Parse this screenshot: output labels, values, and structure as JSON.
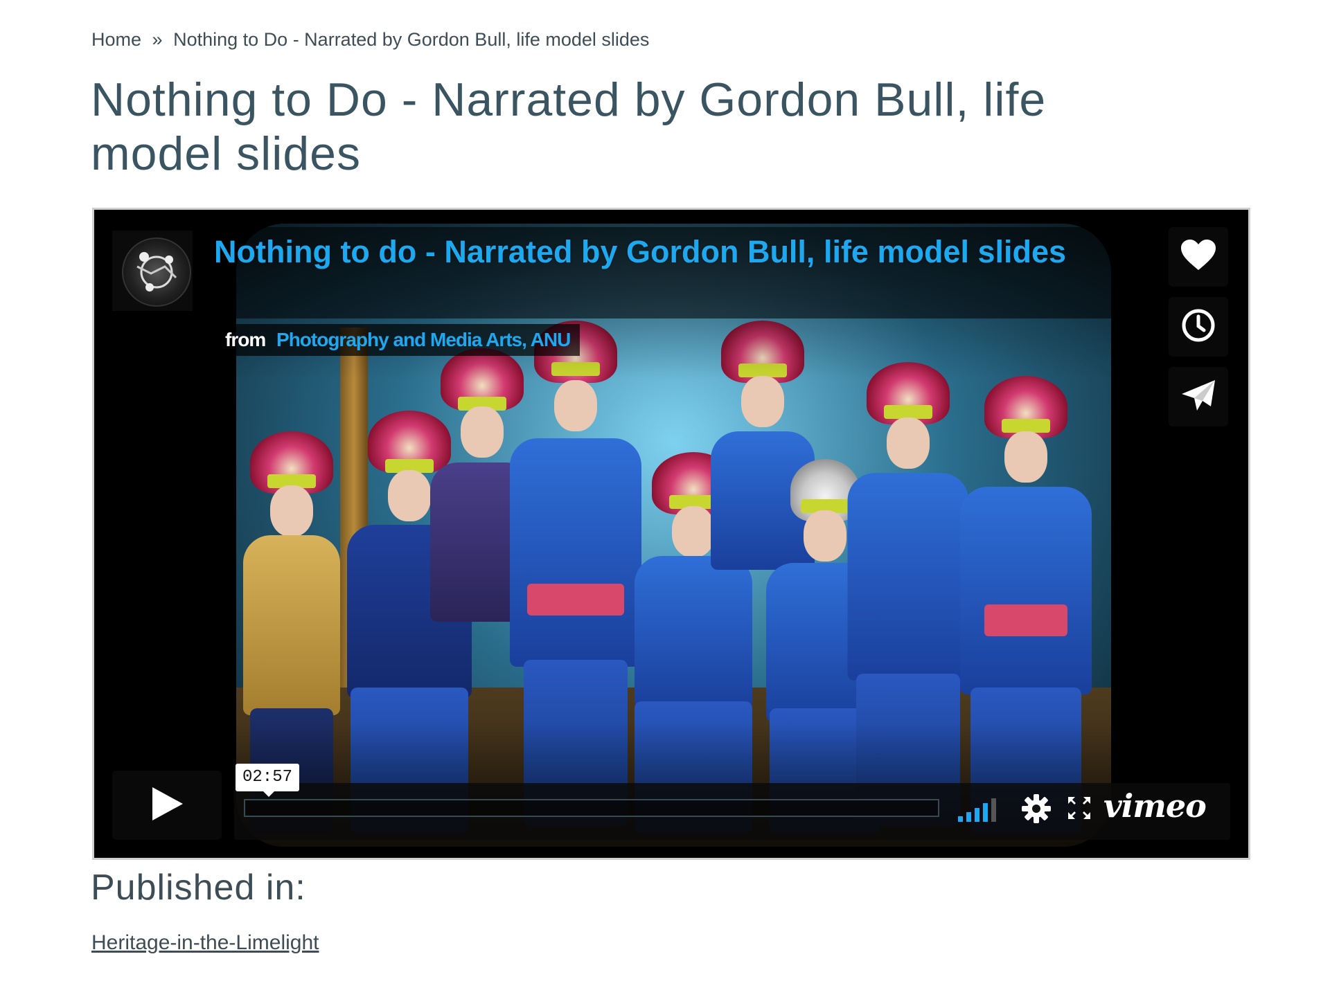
{
  "breadcrumb": {
    "home": "Home",
    "separator": "»",
    "current": "Nothing to Do - Narrated by Gordon Bull, life model slides"
  },
  "page": {
    "title": "Nothing to Do - Narrated by Gordon Bull, life model slides"
  },
  "player": {
    "video_title": "Nothing to do - Narrated by Gordon Bull, life model slides",
    "from_label": "from",
    "channel": "Photography and Media Arts, ANU",
    "timecode": "02:57",
    "progress": 0,
    "brand": "vimeo",
    "accent_color": "#1ea8f0",
    "side_buttons": [
      "heart-icon",
      "clock-icon",
      "paper-plane-icon"
    ],
    "controls": [
      "play-icon",
      "volume-icon",
      "gear-icon",
      "fullscreen-icon"
    ]
  },
  "published": {
    "heading": "Published in:",
    "link": "Heritage-in-the-Limelight"
  }
}
